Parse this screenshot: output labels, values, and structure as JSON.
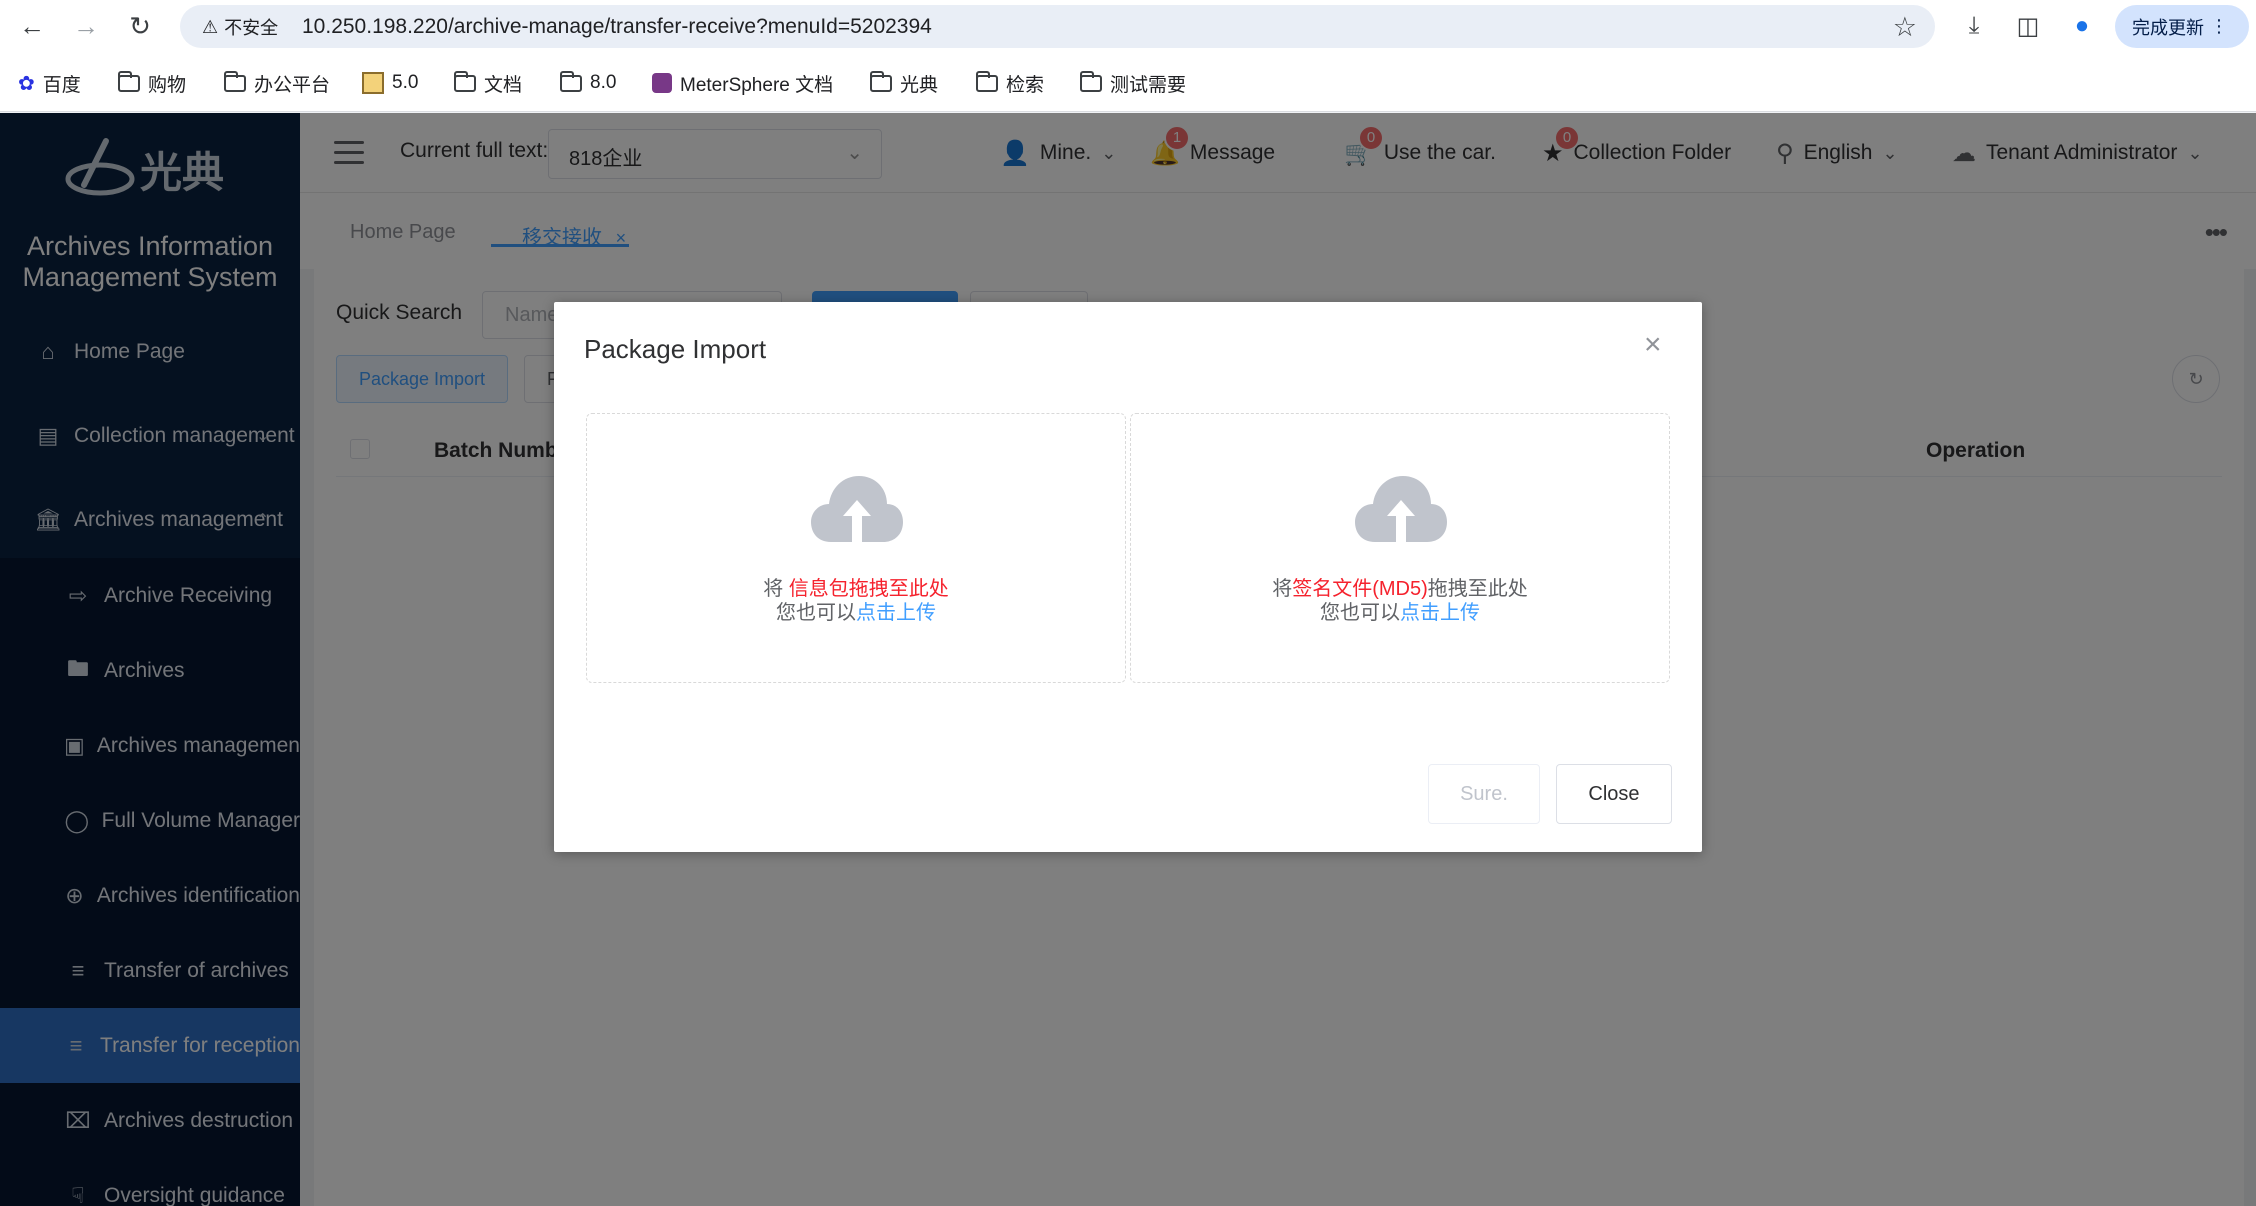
{
  "browser": {
    "insecure_label": "不安全",
    "url": "10.250.198.220/archive-manage/transfer-receive?menuId=5202394",
    "update_label": "完成更新",
    "bookmarks": [
      {
        "label": "百度",
        "icon": "baidu-icon"
      },
      {
        "label": "购物",
        "icon": "folder-icon"
      },
      {
        "label": "办公平台",
        "icon": "folder-icon"
      },
      {
        "label": "5.0",
        "icon": "image-icon"
      },
      {
        "label": "文档",
        "icon": "folder-icon"
      },
      {
        "label": "8.0",
        "icon": "folder-icon"
      },
      {
        "label": "MeterSphere 文档",
        "icon": "metersphere-icon"
      },
      {
        "label": "光典",
        "icon": "folder-icon"
      },
      {
        "label": "检索",
        "icon": "folder-icon"
      },
      {
        "label": "测试需要",
        "icon": "folder-icon"
      }
    ]
  },
  "sidebar": {
    "system_name_line1": "Archives Information",
    "system_name_line2": "Management System",
    "items": [
      {
        "label": "Home Page",
        "icon": "home-icon"
      },
      {
        "label": "Collection management",
        "icon": "collection-icon"
      },
      {
        "label": "Archives management",
        "icon": "bank-icon"
      },
      {
        "label": "Archive Receiving",
        "icon": "receive-icon"
      },
      {
        "label": "Archives",
        "icon": "folder-icon"
      },
      {
        "label": "Archives managemen",
        "icon": "bag-icon"
      },
      {
        "label": "Full Volume Manager",
        "icon": "chart-icon"
      },
      {
        "label": "Archives identification",
        "icon": "target-icon"
      },
      {
        "label": "Transfer of archives",
        "icon": "list-icon"
      },
      {
        "label": "Transfer for reception",
        "icon": "list-icon"
      },
      {
        "label": "Archives destruction",
        "icon": "destroy-icon"
      },
      {
        "label": "Oversight guidance",
        "icon": "guidance-icon"
      }
    ]
  },
  "topbar": {
    "fulltext_label": "Current full text:",
    "fulltext_value": "818企业",
    "mine_label": "Mine.",
    "message_label": "Message",
    "message_count": "1",
    "car_label": "Use the car.",
    "car_count": "0",
    "collection_label": "Collection Folder",
    "collection_count": "0",
    "language_label": "English",
    "tenant_label": "Tenant Administrator"
  },
  "tabs": [
    {
      "label": "Home Page"
    },
    {
      "label": "移交接收",
      "close": "×"
    }
  ],
  "content": {
    "quick_search_label": "Quick Search",
    "quick_search_placeholder": "Name",
    "package_import_label": "Package Import",
    "other_button_label": "F",
    "columns": [
      "Batch Numb",
      "Operation"
    ]
  },
  "dialog": {
    "title": "Package Import",
    "close_glyph": "×",
    "left_zone": {
      "prefix": "将 ",
      "highlight": "信息包拖拽至此处",
      "suffix": "",
      "line2_prefix": "您也可以",
      "line2_link": "点击上传"
    },
    "right_zone": {
      "prefix": "将",
      "highlight": "签名文件(MD5)",
      "suffix": "拖拽至此处",
      "line2_prefix": "您也可以",
      "line2_link": "点击上传"
    },
    "sure_label": "Sure.",
    "close_label": "Close"
  },
  "colors": {
    "sidebar_bg": "#0b2241",
    "active_menu": "#2f6fc5",
    "primary": "#409eff",
    "danger": "#f5222d"
  }
}
